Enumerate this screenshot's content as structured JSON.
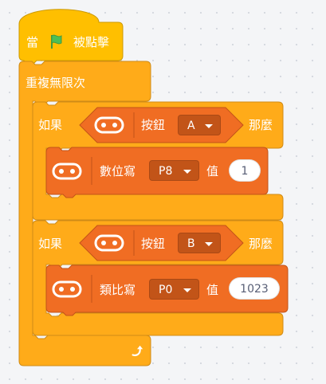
{
  "colors": {
    "control": "#ffab19",
    "control_dark": "#cf8b17",
    "event": "#ffbf00",
    "extension": "#f06d23",
    "extension_dark": "#c25418",
    "flag": "#4cbf56"
  },
  "hat": {
    "label_pre": "當",
    "flag_icon": "green-flag-icon",
    "label_post": "被點擊"
  },
  "forever": {
    "label": "重複無限次",
    "loop_icon": "loop-arrow-icon"
  },
  "if_blocks": [
    {
      "if_label": "如果",
      "then_label": "那麼",
      "condition": {
        "icon": "microbit-icon",
        "label": "按鈕",
        "button_value": "A"
      },
      "action": {
        "icon": "microbit-icon",
        "label": "數位寫",
        "pin_value": "P8",
        "value_label": "值",
        "value": "1"
      }
    },
    {
      "if_label": "如果",
      "then_label": "那麼",
      "condition": {
        "icon": "microbit-icon",
        "label": "按鈕",
        "button_value": "B"
      },
      "action": {
        "icon": "microbit-icon",
        "label": "類比寫",
        "pin_value": "P0",
        "value_label": "值",
        "value": "1023"
      }
    }
  ]
}
